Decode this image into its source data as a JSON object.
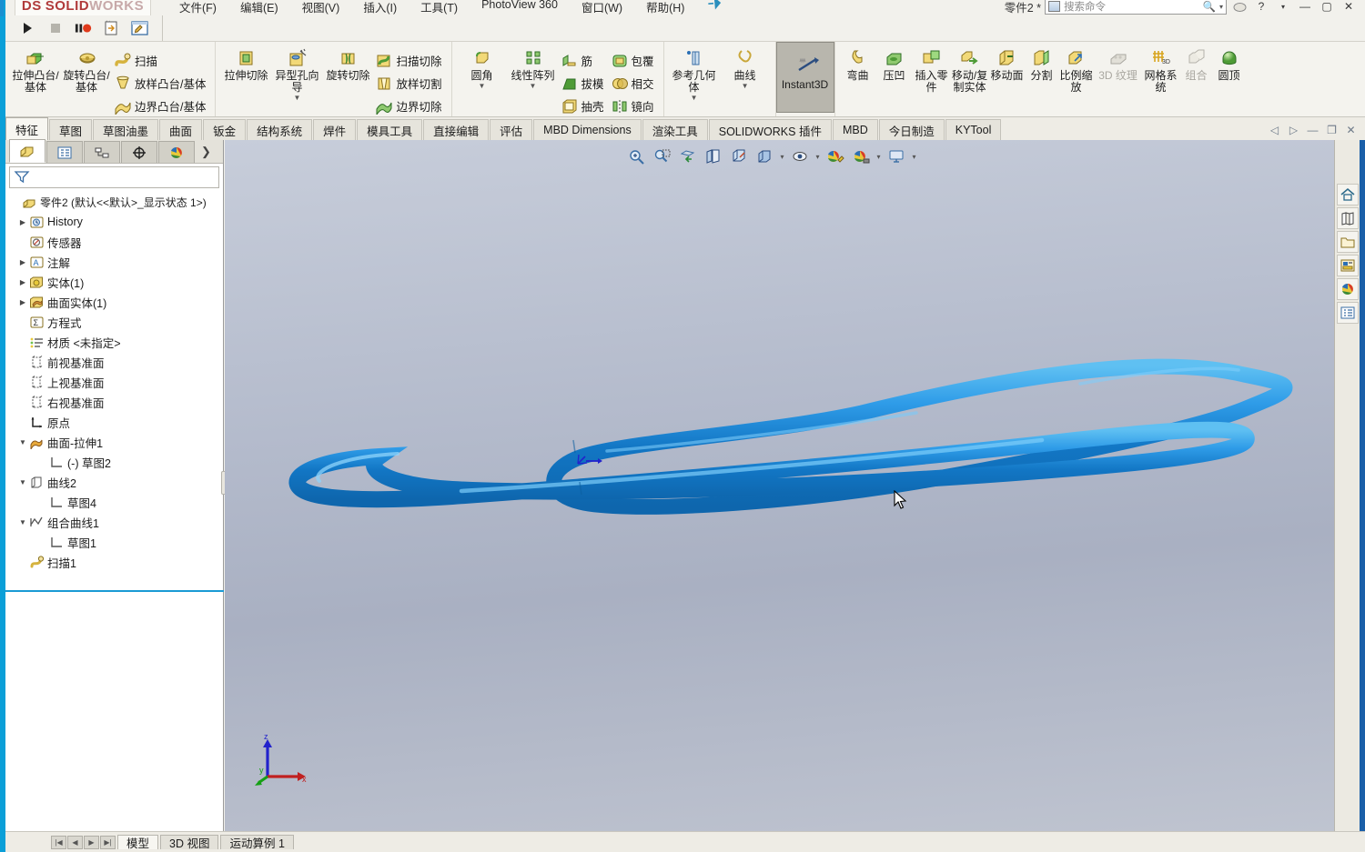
{
  "app": {
    "logo_ds": "DS",
    "logo_solid": "SOLID",
    "logo_works": "WORKS",
    "doc_title": "零件2 *",
    "search_placeholder": "搜索命令"
  },
  "menubar": {
    "items": [
      {
        "label": "文件(F)"
      },
      {
        "label": "编辑(E)"
      },
      {
        "label": "视图(V)"
      },
      {
        "label": "插入(I)"
      },
      {
        "label": "工具(T)"
      },
      {
        "label": "PhotoView 360"
      },
      {
        "label": "窗口(W)"
      },
      {
        "label": "帮助(H)"
      }
    ],
    "pin": "⚲"
  },
  "window_controls": {
    "help": "?",
    "help_caret": "▾",
    "minimize": "—",
    "maximize": "▢",
    "close": "✕"
  },
  "recorder": {
    "play": "play-icon",
    "stop": "stop-icon",
    "pause": "pause-icon",
    "record": "record-icon",
    "capture": "capture-icon",
    "edit": "edit-icon"
  },
  "ribbon": {
    "groups": [
      {
        "name": "boss-base",
        "big": [
          {
            "label": "拉伸凸台/基体",
            "icon": "extrude-boss-icon",
            "disabled": false,
            "caret": false
          },
          {
            "label": "旋转凸台/基体",
            "icon": "revolve-boss-icon",
            "disabled": false,
            "caret": false
          }
        ],
        "small": [
          {
            "label": "扫描",
            "icon": "sweep-icon"
          },
          {
            "label": "放样凸台/基体",
            "icon": "loft-icon"
          },
          {
            "label": "边界凸台/基体",
            "icon": "boundary-icon"
          }
        ]
      },
      {
        "name": "cut",
        "big": [
          {
            "label": "拉伸切除",
            "icon": "extrude-cut-icon",
            "disabled": false,
            "caret": false
          },
          {
            "label": "异型孔向导",
            "icon": "hole-wizard-icon",
            "disabled": false,
            "caret": true
          },
          {
            "label": "旋转切除",
            "icon": "revolve-cut-icon",
            "disabled": false,
            "caret": false
          }
        ],
        "small": [
          {
            "label": "扫描切除",
            "icon": "sweep-cut-icon"
          },
          {
            "label": "放样切割",
            "icon": "loft-cut-icon"
          },
          {
            "label": "边界切除",
            "icon": "boundary-cut-icon"
          }
        ]
      },
      {
        "name": "features",
        "big": [
          {
            "label": "圆角",
            "icon": "fillet-icon",
            "disabled": false,
            "caret": true
          },
          {
            "label": "线性阵列",
            "icon": "linear-pattern-icon",
            "disabled": false,
            "caret": true
          }
        ],
        "small": [
          {
            "label": "筋",
            "icon": "rib-icon"
          },
          {
            "label": "拔模",
            "icon": "draft-icon"
          },
          {
            "label": "抽壳",
            "icon": "shell-icon"
          }
        ],
        "small2": [
          {
            "label": "包覆",
            "icon": "wrap-icon"
          },
          {
            "label": "相交",
            "icon": "intersect-icon"
          },
          {
            "label": "镜向",
            "icon": "mirror-icon"
          }
        ]
      },
      {
        "name": "reference",
        "big": [
          {
            "label": "参考几何体",
            "icon": "reference-geometry-icon",
            "disabled": false,
            "caret": true
          },
          {
            "label": "曲线",
            "icon": "curves-icon",
            "disabled": false,
            "caret": true
          }
        ]
      },
      {
        "name": "instant3d",
        "big": [
          {
            "label": "Instant3D",
            "icon": "instant3d-icon",
            "disabled": false,
            "caret": false,
            "active": true
          }
        ]
      },
      {
        "name": "direct",
        "big": [
          {
            "label": "弯曲",
            "icon": "flex-icon",
            "disabled": false,
            "caret": false
          },
          {
            "label": "压凹",
            "icon": "indent-icon",
            "disabled": false,
            "caret": false
          },
          {
            "label": "插入零件",
            "icon": "insert-part-icon",
            "disabled": false,
            "caret": false
          },
          {
            "label": "移动/复制实体",
            "icon": "move-copy-body-icon",
            "disabled": false,
            "caret": false
          },
          {
            "label": "移动面",
            "icon": "move-face-icon",
            "disabled": false,
            "caret": false
          },
          {
            "label": "分割",
            "icon": "split-icon",
            "disabled": false,
            "caret": false
          },
          {
            "label": "比例缩放",
            "icon": "scale-icon",
            "disabled": false,
            "caret": false
          },
          {
            "label": "3D 纹理",
            "icon": "texture-3d-icon",
            "disabled": true,
            "caret": false
          },
          {
            "label": "网格系统",
            "icon": "mesh-system-icon",
            "disabled": false,
            "caret": false
          },
          {
            "label": "组合",
            "icon": "combine-icon",
            "disabled": true,
            "caret": false
          },
          {
            "label": "圆顶",
            "icon": "dome-icon",
            "disabled": false,
            "caret": false
          }
        ]
      }
    ]
  },
  "command_tabs": {
    "items": [
      {
        "label": "特征",
        "selected": true
      },
      {
        "label": "草图",
        "selected": false
      },
      {
        "label": "草图油墨",
        "selected": false
      },
      {
        "label": "曲面",
        "selected": false
      },
      {
        "label": "钣金",
        "selected": false
      },
      {
        "label": "结构系统",
        "selected": false
      },
      {
        "label": "焊件",
        "selected": false
      },
      {
        "label": "模具工具",
        "selected": false
      },
      {
        "label": "直接编辑",
        "selected": false
      },
      {
        "label": "评估",
        "selected": false
      },
      {
        "label": "MBD Dimensions",
        "selected": false
      },
      {
        "label": "渲染工具",
        "selected": false
      },
      {
        "label": "SOLIDWORKS 插件",
        "selected": false
      },
      {
        "label": "MBD",
        "selected": false
      },
      {
        "label": "今日制造",
        "selected": false
      },
      {
        "label": "KYTool",
        "selected": false
      }
    ],
    "doc_controls": {
      "prev": "◁",
      "next": "▷",
      "minimize": "—",
      "restore": "❐",
      "close": "✕"
    }
  },
  "feature_manager": {
    "tabs": [
      {
        "name": "feature-tree-tab",
        "icon": "feature-tree-icon",
        "selected": true
      },
      {
        "name": "property-manager-tab",
        "icon": "property-manager-icon",
        "selected": false
      },
      {
        "name": "configuration-manager-tab",
        "icon": "configuration-manager-icon",
        "selected": false
      },
      {
        "name": "dimxpert-manager-tab",
        "icon": "dimxpert-icon",
        "selected": false
      },
      {
        "name": "appearances-tab",
        "icon": "appearances-icon",
        "selected": false
      }
    ],
    "expand_arrow": "❯",
    "filter_icon": "filter-icon",
    "root": {
      "label": "零件2  (默认<<默认>_显示状态 1>)",
      "icon": "part-icon"
    },
    "tree": [
      {
        "label": "History",
        "icon": "history-icon",
        "arrow": "▶",
        "indent": 0
      },
      {
        "label": "传感器",
        "icon": "sensor-icon",
        "arrow": "",
        "indent": 0
      },
      {
        "label": "注解",
        "icon": "annotations-icon",
        "arrow": "▶",
        "indent": 0
      },
      {
        "label": "实体(1)",
        "icon": "solid-bodies-icon",
        "arrow": "▶",
        "indent": 0
      },
      {
        "label": "曲面实体(1)",
        "icon": "surface-bodies-icon",
        "arrow": "▶",
        "indent": 0
      },
      {
        "label": "方程式",
        "icon": "equations-icon",
        "arrow": "",
        "indent": 0
      },
      {
        "label": "材质 <未指定>",
        "icon": "material-icon",
        "arrow": "",
        "indent": 0
      },
      {
        "label": "前视基准面",
        "icon": "plane-icon",
        "arrow": "",
        "indent": 0
      },
      {
        "label": "上视基准面",
        "icon": "plane-icon",
        "arrow": "",
        "indent": 0
      },
      {
        "label": "右视基准面",
        "icon": "plane-icon",
        "arrow": "",
        "indent": 0
      },
      {
        "label": "原点",
        "icon": "origin-icon",
        "arrow": "",
        "indent": 0
      },
      {
        "label": "曲面-拉伸1",
        "icon": "surface-extrude-icon",
        "arrow": "▼",
        "indent": 0
      },
      {
        "label": "(-) 草图2",
        "icon": "sketch-icon",
        "arrow": "",
        "indent": 1
      },
      {
        "label": "曲线2",
        "icon": "curve-icon",
        "arrow": "▼",
        "indent": 0
      },
      {
        "label": "草图4",
        "icon": "sketch-icon",
        "arrow": "",
        "indent": 1
      },
      {
        "label": "组合曲线1",
        "icon": "composite-curve-icon",
        "arrow": "▼",
        "indent": 0
      },
      {
        "label": "草图1",
        "icon": "sketch-icon",
        "arrow": "",
        "indent": 1
      },
      {
        "label": "扫描1",
        "icon": "sweep-feature-icon",
        "arrow": "",
        "indent": 0
      }
    ]
  },
  "viewport": {
    "hud_buttons": [
      {
        "name": "zoom-to-fit-icon",
        "caret": false
      },
      {
        "name": "zoom-to-area-icon",
        "caret": false
      },
      {
        "name": "previous-view-icon",
        "caret": false
      },
      {
        "name": "section-view-icon",
        "caret": false
      },
      {
        "name": "view-orientation-icon",
        "caret": false
      },
      {
        "name": "display-style-icon",
        "caret": true
      },
      {
        "name": "hide-show-items-icon",
        "caret": true
      },
      {
        "name": "edit-appearance-icon",
        "caret": false
      },
      {
        "name": "apply-scene-icon",
        "caret": true
      },
      {
        "name": "view-settings-icon",
        "caret": true
      }
    ],
    "triad": {
      "x": "x",
      "y": "y",
      "z": "z"
    },
    "model": {
      "name": "swept-tube-body",
      "color": "#1f8fe0"
    },
    "background_top": "#c7cdda",
    "background_bottom": "#bfc4d0"
  },
  "task_pane": {
    "buttons": [
      {
        "name": "solidworks-resources-icon"
      },
      {
        "name": "design-library-icon"
      },
      {
        "name": "file-explorer-icon"
      },
      {
        "name": "view-palette-icon"
      },
      {
        "name": "appearances-scenes-icon"
      },
      {
        "name": "custom-properties-icon"
      }
    ]
  },
  "bottom": {
    "arrows": [
      "|◀",
      "◀",
      "▶",
      "▶|"
    ],
    "tabs": [
      {
        "label": "模型",
        "selected": true
      },
      {
        "label": "3D 视图",
        "selected": false
      },
      {
        "label": "运动算例 1",
        "selected": false
      }
    ]
  }
}
